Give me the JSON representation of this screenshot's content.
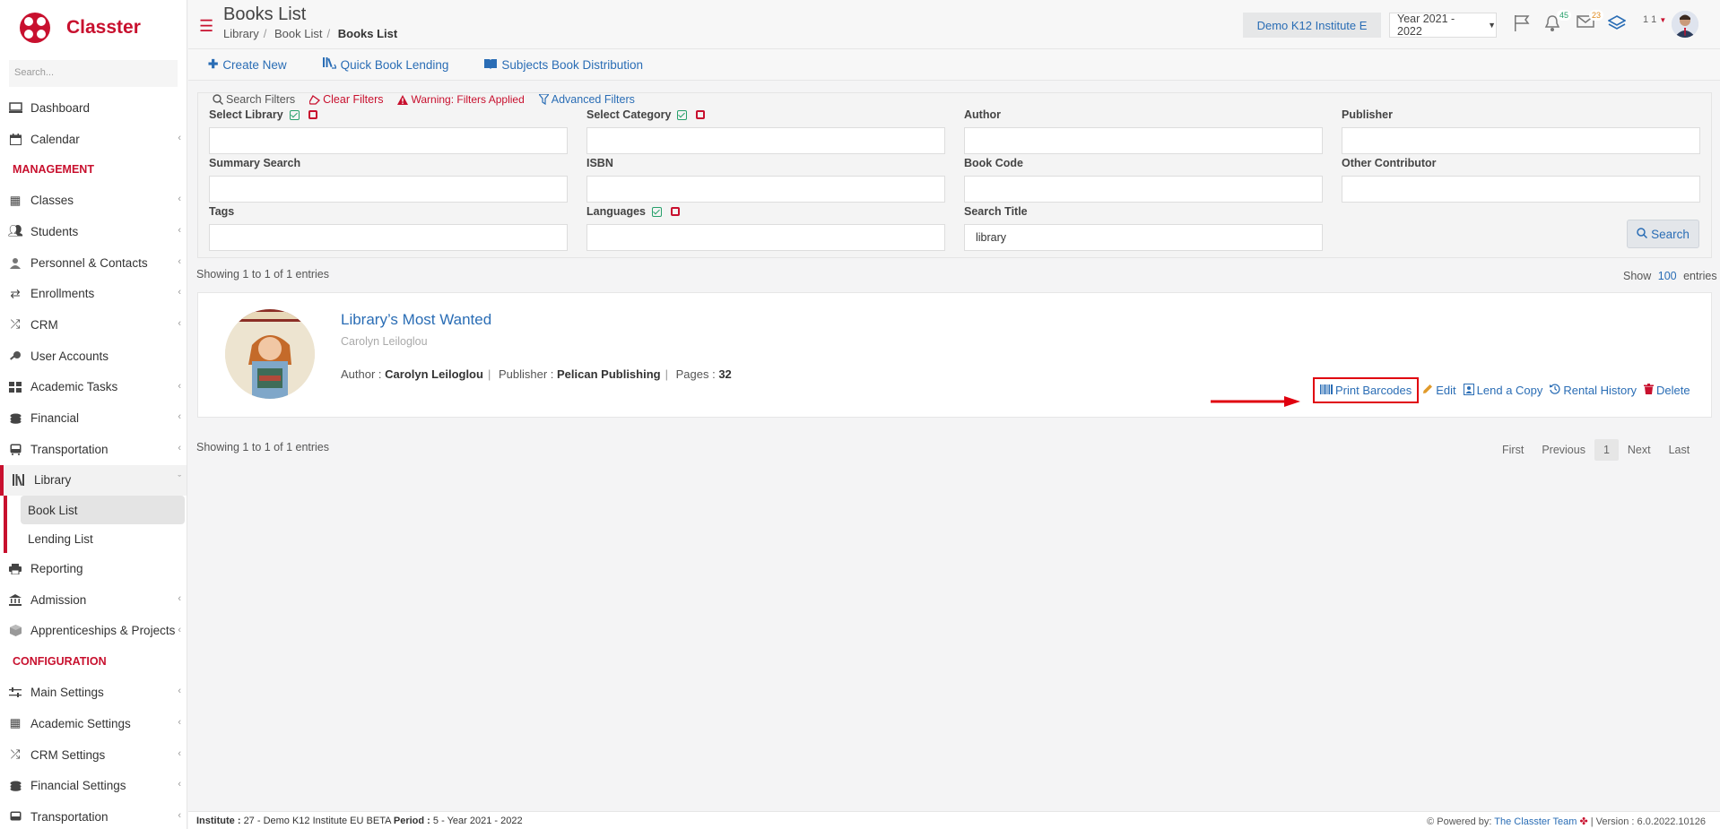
{
  "brand": {
    "name": "Classter"
  },
  "sidebar": {
    "search_placeholder": "Search...",
    "items_top": [
      {
        "label": "Dashboard",
        "icon": "monitor-icon"
      },
      {
        "label": "Calendar",
        "icon": "calendar-icon"
      }
    ],
    "management_header": "MANAGEMENT",
    "management_items": [
      {
        "label": "Classes",
        "icon": "classes-icon"
      },
      {
        "label": "Students",
        "icon": "students-icon"
      },
      {
        "label": "Personnel & Contacts",
        "icon": "person-icon"
      },
      {
        "label": "Enrollments",
        "icon": "exchange-icon"
      },
      {
        "label": "CRM",
        "icon": "shuffle-icon"
      },
      {
        "label": "User Accounts",
        "icon": "key-icon"
      },
      {
        "label": "Academic Tasks",
        "icon": "grid-icon"
      },
      {
        "label": "Financial",
        "icon": "coins-icon"
      },
      {
        "label": "Transportation",
        "icon": "bus-icon"
      }
    ],
    "library": {
      "label": "Library",
      "sub": [
        "Book List",
        "Lending List"
      ]
    },
    "management_items_after": [
      {
        "label": "Reporting",
        "icon": "print-icon"
      },
      {
        "label": "Admission",
        "icon": "bank-icon"
      },
      {
        "label": "Apprenticeships & Projects",
        "icon": "box-icon"
      }
    ],
    "configuration_header": "CONFIGURATION",
    "configuration_items": [
      {
        "label": "Main Settings",
        "icon": "sliders-icon"
      },
      {
        "label": "Academic Settings",
        "icon": "classes-icon"
      },
      {
        "label": "CRM Settings",
        "icon": "shuffle-icon"
      },
      {
        "label": "Financial Settings",
        "icon": "coins-icon"
      },
      {
        "label": "Transportation",
        "icon": "bus-icon"
      }
    ]
  },
  "header": {
    "title": "Books List",
    "breadcrumb": [
      "Library",
      "Book List",
      "Books List"
    ],
    "institute": "Demo K12 Institute E",
    "year": "Year 2021 - 2022",
    "notifications_count": "45",
    "messages_count": "23",
    "user_short": "1 1"
  },
  "toolbar": {
    "create_new": "Create New",
    "quick_lending": "Quick Book Lending",
    "subjects_distribution": "Subjects Book Distribution"
  },
  "filters": {
    "search_filters": "Search Filters",
    "clear_filters": "Clear Filters",
    "warning": "Warning: Filters Applied",
    "advanced": "Advanced Filters",
    "fields": {
      "select_library": {
        "label": "Select Library",
        "value": ""
      },
      "select_category": {
        "label": "Select Category",
        "value": ""
      },
      "author": {
        "label": "Author",
        "value": ""
      },
      "publisher": {
        "label": "Publisher",
        "value": ""
      },
      "summary_search": {
        "label": "Summary Search",
        "value": ""
      },
      "isbn": {
        "label": "ISBN",
        "value": ""
      },
      "book_code": {
        "label": "Book Code",
        "value": ""
      },
      "other_contributor": {
        "label": "Other Contributor",
        "value": ""
      },
      "tags": {
        "label": "Tags",
        "value": ""
      },
      "languages": {
        "label": "Languages",
        "value": ""
      },
      "search_title": {
        "label": "Search Title",
        "value": "library"
      }
    },
    "search_button": "Search"
  },
  "results": {
    "showing_text": "Showing 1 to 1 of 1 entries",
    "show_label": "Show",
    "show_count": "100",
    "entries_label": "entries"
  },
  "book": {
    "title": "Library’s Most Wanted",
    "subtitle": "Carolyn Leiloglou",
    "author_label": "Author :",
    "author": "Carolyn Leiloglou",
    "publisher_label": "Publisher :",
    "publisher": "Pelican Publishing",
    "pages_label": "Pages :",
    "pages": "32",
    "actions": {
      "print_barcodes": "Print Barcodes",
      "edit": "Edit",
      "lend": "Lend a Copy",
      "rental_history": "Rental History",
      "delete": "Delete"
    }
  },
  "pagination": {
    "first": "First",
    "previous": "Previous",
    "current": "1",
    "next": "Next",
    "last": "Last"
  },
  "footer": {
    "institute_label": "Institute :",
    "institute": "27 - Demo K12 Institute EU BETA",
    "period_label": "Period :",
    "period": "5 - Year 2021 - 2022",
    "powered_by": "Powered by:",
    "team": "The Classter Team",
    "version": "| Version : 6.0.2022.10126"
  },
  "colors": {
    "brand_red": "#c8102e",
    "link_blue": "#2a6db5",
    "highlight_red": "#e0000f"
  }
}
